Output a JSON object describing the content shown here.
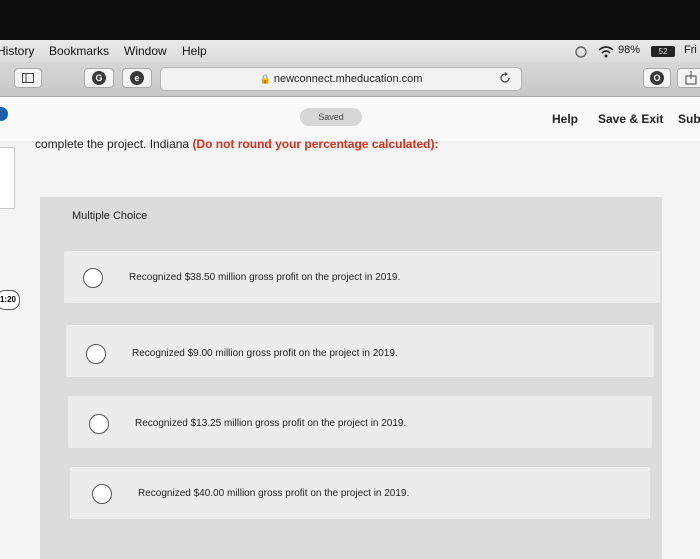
{
  "menubar": {
    "items": [
      "History",
      "Bookmarks",
      "Window",
      "Help"
    ],
    "battery": "98%",
    "battery_badge": "52",
    "clock_partial": "Fri"
  },
  "browser": {
    "url": "newconnect.mheducation.com"
  },
  "header": {
    "saved_label": "Saved",
    "help_label": "Help",
    "save_exit_label": "Save & Exit",
    "submit_label": "Sub"
  },
  "timer_badge": "1:20",
  "question": {
    "text": "complete the project. Indiana ",
    "instruction": "(Do not round your percentage calculated):"
  },
  "multiple_choice": {
    "title": "Multiple Choice",
    "options": [
      "Recognized $38.50 million gross profit on the project in 2019.",
      "Recognized $9.00 million gross profit on the project in 2019.",
      "Recognized $13.25 million gross profit on the project in 2019.",
      "Recognized $40.00 million gross profit on the project in 2019."
    ]
  }
}
